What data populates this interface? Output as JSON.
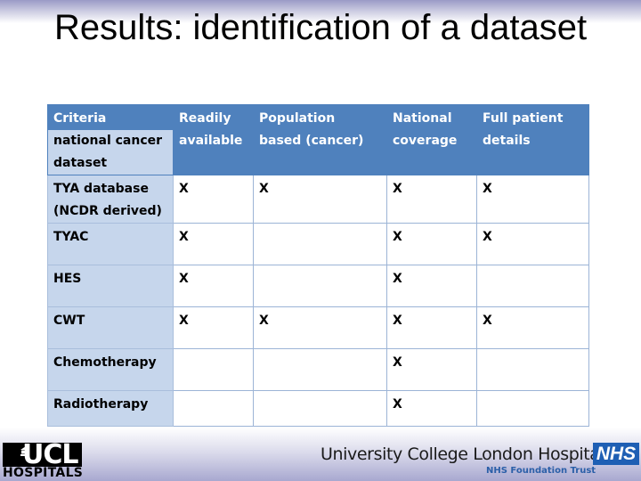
{
  "slide": {
    "title": "Results: identification of a dataset"
  },
  "table": {
    "header": {
      "criteria_label": "Criteria",
      "row_label_caption": "national cancer dataset",
      "columns": [
        "Readily available",
        "Population based (cancer)",
        "National coverage",
        "Full patient details"
      ]
    },
    "rows": [
      {
        "name": "TYA database (NCDR derived)",
        "values": [
          "X",
          "X",
          "X",
          "X"
        ]
      },
      {
        "name": "TYAC",
        "values": [
          "X",
          "",
          "X",
          "X"
        ]
      },
      {
        "name": "HES",
        "values": [
          "X",
          "",
          "X",
          ""
        ]
      },
      {
        "name": "CWT",
        "values": [
          "X",
          "X",
          "X",
          "X"
        ]
      },
      {
        "name": "Chemotherapy",
        "values": [
          "",
          "",
          "X",
          ""
        ]
      },
      {
        "name": "Radiotherapy",
        "values": [
          "",
          "",
          "X",
          ""
        ]
      }
    ]
  },
  "footer": {
    "ucl_logo_top": "UCL",
    "ucl_logo_bottom": "HOSPITALS",
    "trust_name": "University College London Hospitals",
    "trust_subtitle": "NHS Foundation Trust",
    "nhs_badge": "NHS"
  },
  "colors": {
    "header_blue": "#4f81bd",
    "label_column": "#c6d6ec",
    "nhs_blue": "#1e5fb4"
  }
}
